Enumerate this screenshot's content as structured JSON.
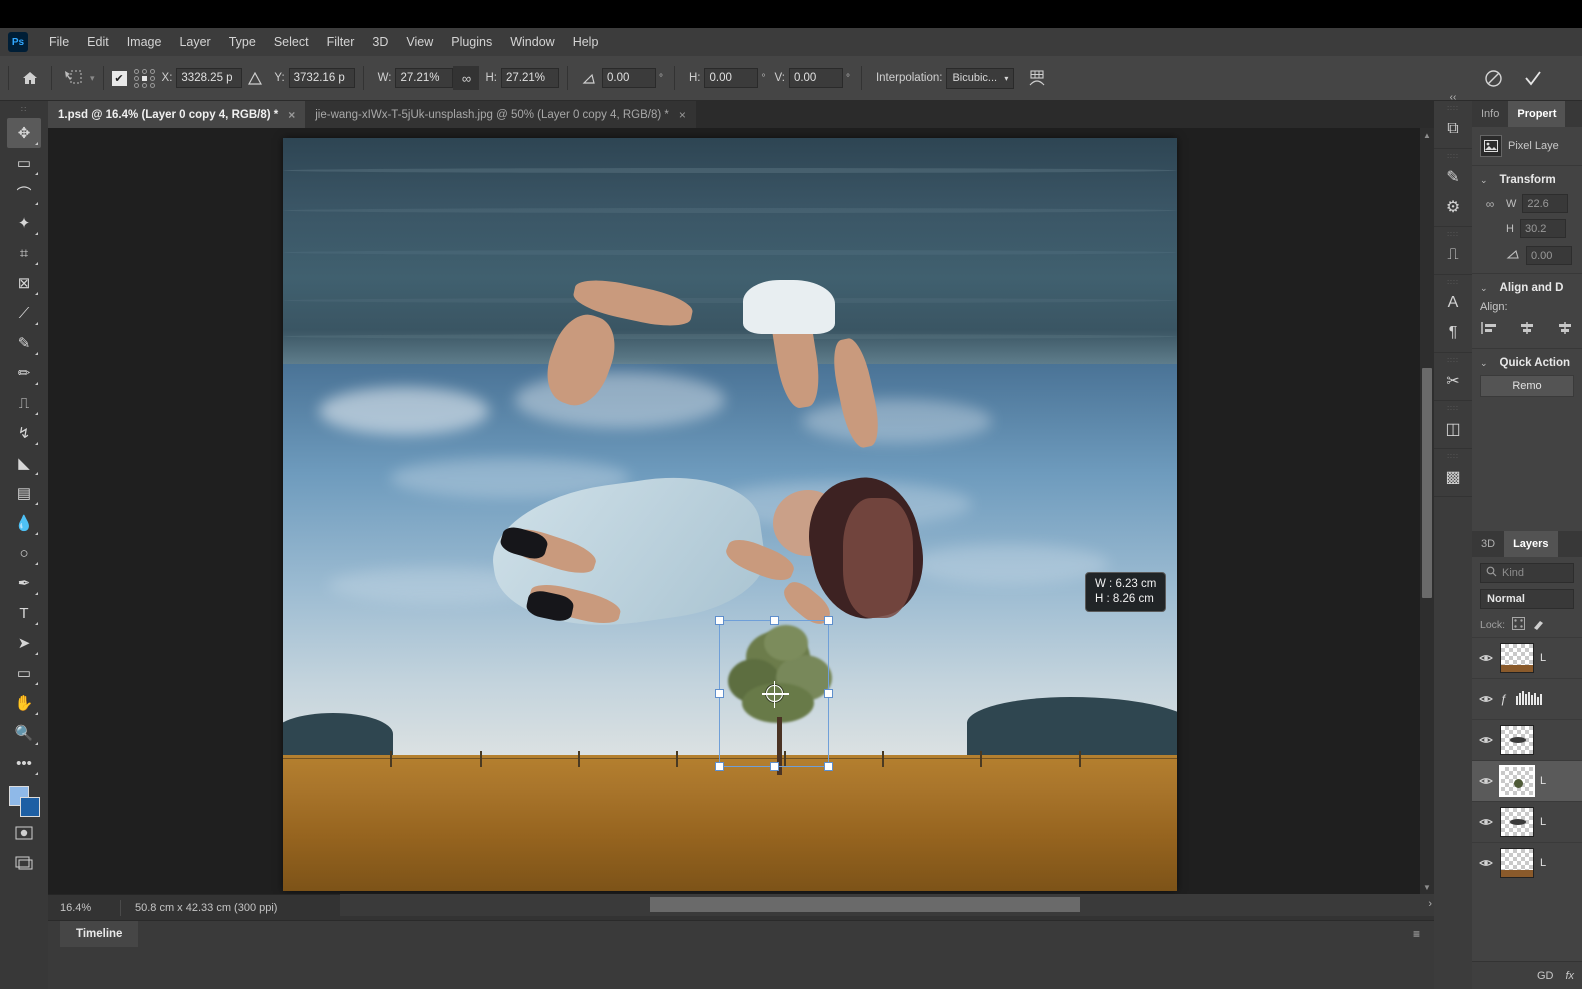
{
  "app": {
    "name": "Ps"
  },
  "menubar": {
    "items": [
      "File",
      "Edit",
      "Image",
      "Layer",
      "Type",
      "Select",
      "Filter",
      "3D",
      "View",
      "Plugins",
      "Window",
      "Help"
    ]
  },
  "options_bar": {
    "home_icon": "home-icon",
    "tool_icon": "free-transform-icon",
    "checkbox_checked": true,
    "reference_point_icon": "reference-point-grid",
    "x_label": "X:",
    "x_value": "3328.25 p",
    "delta_icon": "relative-position-icon",
    "y_label": "Y:",
    "y_value": "3732.16 p",
    "w_label": "W:",
    "w_value": "27.21%",
    "link_icon": "link-chain-icon",
    "h_label": "H:",
    "h_value": "27.21%",
    "angle_label": "angle-icon",
    "angle_value": "0.00",
    "degree": "°",
    "skew_h_label": "H:",
    "skew_h_value": "0.00",
    "skew_v_label": "V:",
    "skew_v_value": "0.00",
    "interpolation_label": "Interpolation:",
    "interpolation_value": "Bicubic...",
    "warp_icon": "warp-icon",
    "cancel_icon": "cancel-transform-icon",
    "commit_icon": "commit-transform-icon"
  },
  "tabs": [
    {
      "label": "1.psd @ 16.4% (Layer 0 copy 4, RGB/8) *",
      "active": true,
      "close": "×"
    },
    {
      "label": "jie-wang-xIWx-T-5jUk-unsplash.jpg @ 50% (Layer 0 copy 4, RGB/8) *",
      "active": false,
      "close": "×"
    }
  ],
  "toolbar": {
    "tools": [
      {
        "name": "move-tool",
        "glyph": "✥",
        "selected": true
      },
      {
        "name": "rectangular-marquee-tool",
        "glyph": "▭",
        "selected": false
      },
      {
        "name": "lasso-tool",
        "glyph": "⌒",
        "selected": false
      },
      {
        "name": "object-selection-tool",
        "glyph": "✦",
        "selected": false
      },
      {
        "name": "crop-tool",
        "glyph": "⌗",
        "selected": false
      },
      {
        "name": "frame-tool",
        "glyph": "⊠",
        "selected": false
      },
      {
        "name": "eyedropper-tool",
        "glyph": "⟋",
        "selected": false
      },
      {
        "name": "spot-healing-brush-tool",
        "glyph": "✎",
        "selected": false
      },
      {
        "name": "brush-tool",
        "glyph": "✏",
        "selected": false
      },
      {
        "name": "clone-stamp-tool",
        "glyph": "⎍",
        "selected": false
      },
      {
        "name": "history-brush-tool",
        "glyph": "↯",
        "selected": false
      },
      {
        "name": "eraser-tool",
        "glyph": "◣",
        "selected": false
      },
      {
        "name": "gradient-tool",
        "glyph": "▤",
        "selected": false
      },
      {
        "name": "blur-tool",
        "glyph": "💧",
        "selected": false
      },
      {
        "name": "dodge-tool",
        "glyph": "○",
        "selected": false
      },
      {
        "name": "pen-tool",
        "glyph": "✒",
        "selected": false
      },
      {
        "name": "horizontal-type-tool",
        "glyph": "T",
        "selected": false
      },
      {
        "name": "path-selection-tool",
        "glyph": "➤",
        "selected": false
      },
      {
        "name": "rectangle-tool",
        "glyph": "▭",
        "selected": false
      },
      {
        "name": "hand-tool",
        "glyph": "✋",
        "selected": false
      },
      {
        "name": "zoom-tool",
        "glyph": "🔍",
        "selected": false
      },
      {
        "name": "edit-toolbar-tool",
        "glyph": "•••",
        "selected": false
      }
    ],
    "foreground_color": "#8fb9e8",
    "background_color": "#1d5fa4",
    "default_colors_icon": "default-colors-icon",
    "swap_colors_icon": "swap-colors-icon"
  },
  "canvas": {
    "transform_hud": {
      "w_line": "W : 6.23 cm",
      "h_line": "H : 8.26 cm"
    },
    "selection_color": "#6f9fd8",
    "handle_color": "#ffffff"
  },
  "status_bar": {
    "zoom": "16.4%",
    "dimensions": "50.8 cm x 42.33 cm (300 ppi)",
    "expand_arrow": "›",
    "collapse_arrow": "‹",
    "right_arrow": "›"
  },
  "timeline": {
    "tab_label": "Timeline",
    "menu_icon": "panel-menu-icon"
  },
  "right_rail": {
    "collapse_icon": "collapse-panels-icon",
    "groups": [
      [
        {
          "name": "history-icon",
          "glyph": "⧉"
        }
      ],
      [
        {
          "name": "brush-settings-icon",
          "glyph": "✎"
        },
        {
          "name": "brush-presets-icon",
          "glyph": "⚙"
        }
      ],
      [
        {
          "name": "clone-source-icon",
          "glyph": "⎍"
        }
      ],
      [
        {
          "name": "character-panel-icon",
          "glyph": "A"
        },
        {
          "name": "paragraph-panel-icon",
          "glyph": "¶"
        }
      ],
      [
        {
          "name": "tool-presets-icon",
          "glyph": "✂"
        }
      ],
      [
        {
          "name": "libraries-icon",
          "glyph": "◫"
        }
      ],
      [
        {
          "name": "adjustments-icon",
          "glyph": "▩"
        }
      ]
    ]
  },
  "properties_panel": {
    "tabs": [
      {
        "label": "Info",
        "active": false
      },
      {
        "label": "Propert",
        "active": true
      }
    ],
    "layer_type_icon": "pixel-layer-icon",
    "layer_type_label": "Pixel Laye",
    "transform": {
      "title": "Transform",
      "link_icon": "link-dimensions-icon",
      "w_label": "W",
      "w_value": "22.6",
      "h_label": "H",
      "h_value": "30.2",
      "angle_icon": "angle-icon",
      "angle_value": "0.00"
    },
    "align": {
      "title": "Align and D",
      "label": "Align:",
      "buttons": [
        "align-left-icon",
        "align-center-h-icon",
        "align-right-icon"
      ]
    },
    "quick_actions": {
      "title": "Quick Action",
      "button_label": "Remo"
    }
  },
  "layers_panel": {
    "tabs": [
      {
        "label": "3D",
        "active": false
      },
      {
        "label": "Layers",
        "active": true
      }
    ],
    "filter_placeholder": "Kind",
    "filter_icon": "search-icon",
    "blend_mode": "Normal",
    "lock_label": "Lock:",
    "lock_icons": [
      "lock-transparent-pixels-icon",
      "lock-image-pixels-icon"
    ],
    "rows": [
      {
        "name": "layer-row-1",
        "visible": true,
        "thumb": "ground",
        "label": "L",
        "selected": false
      },
      {
        "name": "layer-row-2",
        "visible": true,
        "thumb": "fx-levels",
        "label": "",
        "selected": false
      },
      {
        "name": "layer-row-3",
        "visible": true,
        "thumb": "bird",
        "label": "",
        "selected": false
      },
      {
        "name": "layer-row-4",
        "visible": true,
        "thumb": "tree",
        "label": "L",
        "selected": true
      },
      {
        "name": "layer-row-5",
        "visible": true,
        "thumb": "shadow",
        "label": "L",
        "selected": false
      },
      {
        "name": "layer-row-6",
        "visible": true,
        "thumb": "dirt",
        "label": "L",
        "selected": false
      }
    ],
    "footer_icons": [
      "link-layers-icon",
      "layer-styles-icon"
    ],
    "eye_glyph": "👁"
  }
}
